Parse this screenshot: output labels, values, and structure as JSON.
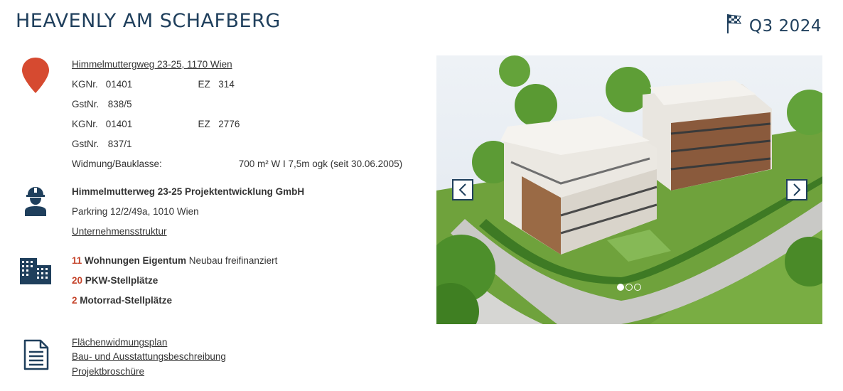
{
  "header": {
    "title": "HEAVENLY AM SCHAFBERG",
    "quarter": "Q3 2024",
    "flag_icon": "checkered-flag-icon"
  },
  "location": {
    "icon": "map-pin-icon",
    "address": "Himmelmuttergweg 23-25, 1170 Wien",
    "parcels": [
      {
        "kg_label": "KGNr.",
        "kg_value": "01401",
        "ez_label": "EZ",
        "ez_value": "314",
        "gst_label": "GstNr.",
        "gst_value": "838/5"
      },
      {
        "kg_label": "KGNr.",
        "kg_value": "01401",
        "ez_label": "EZ",
        "ez_value": "2776",
        "gst_label": "GstNr.",
        "gst_value": "837/1"
      }
    ],
    "zoning_label": "Widmung/Bauklasse:",
    "zoning_value": "700 m² W I 7,5m ogk (seit 30.06.2005)"
  },
  "developer": {
    "icon": "construction-worker-icon",
    "name": "Himmelmutterweg 23-25 Projektentwicklung GmbH",
    "address": "Parkring 12/2/49a, 1010 Wien",
    "structure_link": "Unternehmensstruktur"
  },
  "units": {
    "icon": "buildings-icon",
    "items": [
      {
        "number": "11",
        "label": "Wohnungen Eigentum",
        "extra": "Neubau freifinanziert"
      },
      {
        "number": "20",
        "label": "PKW-Stellplätze",
        "extra": ""
      },
      {
        "number": "2",
        "label": "Motorrad-Stellplätze",
        "extra": ""
      }
    ]
  },
  "documents": {
    "icon": "document-icon",
    "links": [
      "Flächenwidmungsplan",
      "Bau- und Ausstattungsbeschreibung",
      "Projektbroschüre"
    ]
  },
  "gallery": {
    "prev_icon": "chevron-left-icon",
    "next_icon": "chevron-right-icon",
    "slide_count": 3,
    "active_slide": 1
  },
  "colors": {
    "navy": "#1f3f5c",
    "accent_red": "#c5442b",
    "text": "#333333"
  }
}
